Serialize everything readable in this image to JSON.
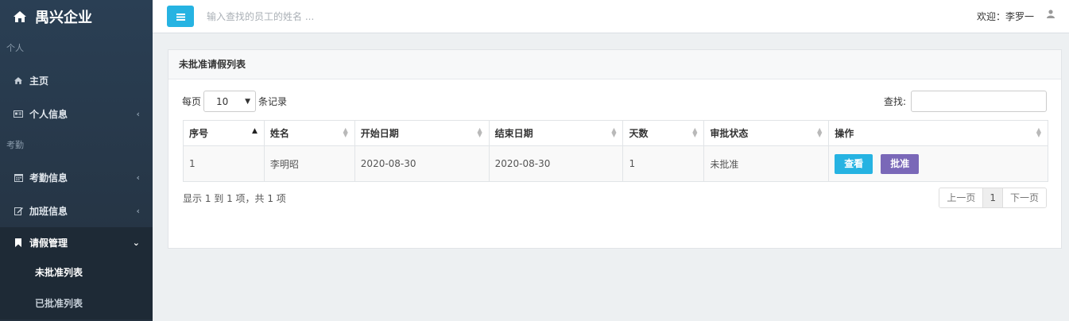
{
  "brand": {
    "title": "禺兴企业"
  },
  "sidebar": {
    "sections": [
      "个人",
      "考勤"
    ],
    "items": [
      {
        "label": "主页"
      },
      {
        "label": "个人信息",
        "chev": "‹"
      },
      {
        "label": "考勤信息",
        "chev": "‹"
      },
      {
        "label": "加班信息",
        "chev": "‹"
      },
      {
        "label": "请假管理",
        "chev": "⌄"
      }
    ],
    "subitems": [
      {
        "label": "未批准列表"
      },
      {
        "label": "已批准列表"
      }
    ]
  },
  "topbar": {
    "search_placeholder": "输入查找的员工的姓名 ...",
    "welcome": "欢迎：李罗一"
  },
  "panel": {
    "title": "未批准请假列表",
    "length_prefix": "每页",
    "length_value": "10",
    "length_suffix": "条记录",
    "filter_label": "查找:",
    "info": "显示 1 到 1 项，共 1 项",
    "pager": {
      "prev": "上一页",
      "current": "1",
      "next": "下一页"
    }
  },
  "table": {
    "columns": [
      "序号",
      "姓名",
      "开始日期",
      "结束日期",
      "天数",
      "审批状态",
      "操作"
    ],
    "rows": [
      {
        "id": "1",
        "name": "李明昭",
        "start": "2020-08-30",
        "end": "2020-08-30",
        "days": "1",
        "status": "未批准",
        "view": "查看",
        "approve": "批准"
      }
    ]
  },
  "colors": {
    "sidebar": "#2a3f54",
    "accent": "#26b3e2",
    "approve": "#7a68b8"
  }
}
